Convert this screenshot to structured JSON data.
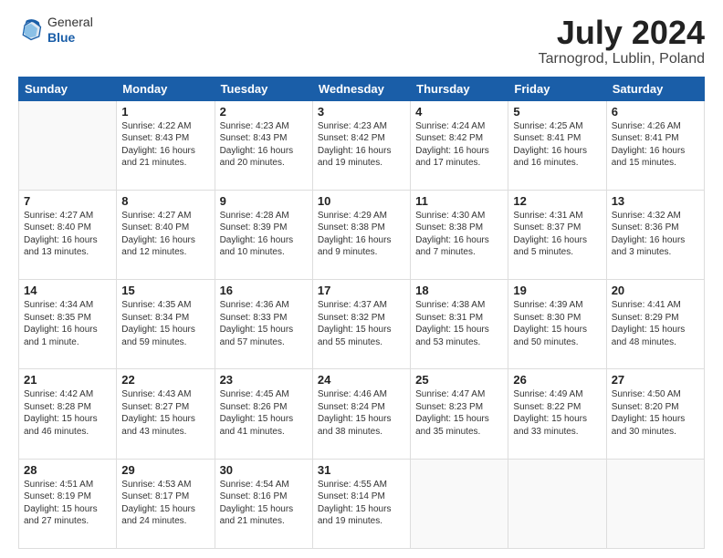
{
  "logo": {
    "general": "General",
    "blue": "Blue"
  },
  "title": "July 2024",
  "subtitle": "Tarnogrod, Lublin, Poland",
  "headers": [
    "Sunday",
    "Monday",
    "Tuesday",
    "Wednesday",
    "Thursday",
    "Friday",
    "Saturday"
  ],
  "weeks": [
    [
      {
        "day": "",
        "info": ""
      },
      {
        "day": "1",
        "info": "Sunrise: 4:22 AM\nSunset: 8:43 PM\nDaylight: 16 hours\nand 21 minutes."
      },
      {
        "day": "2",
        "info": "Sunrise: 4:23 AM\nSunset: 8:43 PM\nDaylight: 16 hours\nand 20 minutes."
      },
      {
        "day": "3",
        "info": "Sunrise: 4:23 AM\nSunset: 8:42 PM\nDaylight: 16 hours\nand 19 minutes."
      },
      {
        "day": "4",
        "info": "Sunrise: 4:24 AM\nSunset: 8:42 PM\nDaylight: 16 hours\nand 17 minutes."
      },
      {
        "day": "5",
        "info": "Sunrise: 4:25 AM\nSunset: 8:41 PM\nDaylight: 16 hours\nand 16 minutes."
      },
      {
        "day": "6",
        "info": "Sunrise: 4:26 AM\nSunset: 8:41 PM\nDaylight: 16 hours\nand 15 minutes."
      }
    ],
    [
      {
        "day": "7",
        "info": "Sunrise: 4:27 AM\nSunset: 8:40 PM\nDaylight: 16 hours\nand 13 minutes."
      },
      {
        "day": "8",
        "info": "Sunrise: 4:27 AM\nSunset: 8:40 PM\nDaylight: 16 hours\nand 12 minutes."
      },
      {
        "day": "9",
        "info": "Sunrise: 4:28 AM\nSunset: 8:39 PM\nDaylight: 16 hours\nand 10 minutes."
      },
      {
        "day": "10",
        "info": "Sunrise: 4:29 AM\nSunset: 8:38 PM\nDaylight: 16 hours\nand 9 minutes."
      },
      {
        "day": "11",
        "info": "Sunrise: 4:30 AM\nSunset: 8:38 PM\nDaylight: 16 hours\nand 7 minutes."
      },
      {
        "day": "12",
        "info": "Sunrise: 4:31 AM\nSunset: 8:37 PM\nDaylight: 16 hours\nand 5 minutes."
      },
      {
        "day": "13",
        "info": "Sunrise: 4:32 AM\nSunset: 8:36 PM\nDaylight: 16 hours\nand 3 minutes."
      }
    ],
    [
      {
        "day": "14",
        "info": "Sunrise: 4:34 AM\nSunset: 8:35 PM\nDaylight: 16 hours\nand 1 minute."
      },
      {
        "day": "15",
        "info": "Sunrise: 4:35 AM\nSunset: 8:34 PM\nDaylight: 15 hours\nand 59 minutes."
      },
      {
        "day": "16",
        "info": "Sunrise: 4:36 AM\nSunset: 8:33 PM\nDaylight: 15 hours\nand 57 minutes."
      },
      {
        "day": "17",
        "info": "Sunrise: 4:37 AM\nSunset: 8:32 PM\nDaylight: 15 hours\nand 55 minutes."
      },
      {
        "day": "18",
        "info": "Sunrise: 4:38 AM\nSunset: 8:31 PM\nDaylight: 15 hours\nand 53 minutes."
      },
      {
        "day": "19",
        "info": "Sunrise: 4:39 AM\nSunset: 8:30 PM\nDaylight: 15 hours\nand 50 minutes."
      },
      {
        "day": "20",
        "info": "Sunrise: 4:41 AM\nSunset: 8:29 PM\nDaylight: 15 hours\nand 48 minutes."
      }
    ],
    [
      {
        "day": "21",
        "info": "Sunrise: 4:42 AM\nSunset: 8:28 PM\nDaylight: 15 hours\nand 46 minutes."
      },
      {
        "day": "22",
        "info": "Sunrise: 4:43 AM\nSunset: 8:27 PM\nDaylight: 15 hours\nand 43 minutes."
      },
      {
        "day": "23",
        "info": "Sunrise: 4:45 AM\nSunset: 8:26 PM\nDaylight: 15 hours\nand 41 minutes."
      },
      {
        "day": "24",
        "info": "Sunrise: 4:46 AM\nSunset: 8:24 PM\nDaylight: 15 hours\nand 38 minutes."
      },
      {
        "day": "25",
        "info": "Sunrise: 4:47 AM\nSunset: 8:23 PM\nDaylight: 15 hours\nand 35 minutes."
      },
      {
        "day": "26",
        "info": "Sunrise: 4:49 AM\nSunset: 8:22 PM\nDaylight: 15 hours\nand 33 minutes."
      },
      {
        "day": "27",
        "info": "Sunrise: 4:50 AM\nSunset: 8:20 PM\nDaylight: 15 hours\nand 30 minutes."
      }
    ],
    [
      {
        "day": "28",
        "info": "Sunrise: 4:51 AM\nSunset: 8:19 PM\nDaylight: 15 hours\nand 27 minutes."
      },
      {
        "day": "29",
        "info": "Sunrise: 4:53 AM\nSunset: 8:17 PM\nDaylight: 15 hours\nand 24 minutes."
      },
      {
        "day": "30",
        "info": "Sunrise: 4:54 AM\nSunset: 8:16 PM\nDaylight: 15 hours\nand 21 minutes."
      },
      {
        "day": "31",
        "info": "Sunrise: 4:55 AM\nSunset: 8:14 PM\nDaylight: 15 hours\nand 19 minutes."
      },
      {
        "day": "",
        "info": ""
      },
      {
        "day": "",
        "info": ""
      },
      {
        "day": "",
        "info": ""
      }
    ]
  ]
}
